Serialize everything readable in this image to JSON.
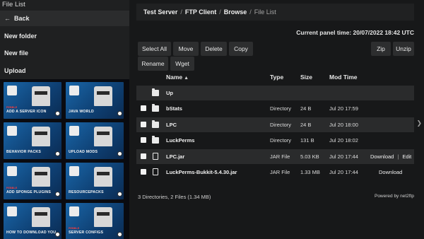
{
  "sidebar": {
    "title": "File List",
    "back_label": "Back",
    "new_folder_label": "New folder",
    "new_file_label": "New file",
    "upload_label": "Upload",
    "tiles": [
      {
        "caption": "ADD A SERVER ICON",
        "brand": "PEBBLE",
        "bg": "#1a66a8"
      },
      {
        "caption": "JAVA WORLD",
        "brand": "",
        "bg": "#1a66a8"
      },
      {
        "caption": "BEHAVIOR PACKS",
        "brand": "",
        "bg": "#1a66a8"
      },
      {
        "caption": "UPLOAD MODS",
        "brand": "",
        "bg": "#1a66a8"
      },
      {
        "caption": "ADD SPONGE PLUGINS",
        "brand": "PEBBLE",
        "bg": "#1a66a8"
      },
      {
        "caption": "RESOURCEPACKS",
        "brand": "",
        "bg": "#1a66a8"
      },
      {
        "caption": "HOW TO DOWNLOAD YOUR WORLD",
        "brand": "",
        "bg": "#1a66a8"
      },
      {
        "caption": "SERVER CONFIGS",
        "brand": "PEBBLE",
        "bg": "#1a66a8"
      }
    ]
  },
  "breadcrumb": {
    "items": [
      "Test Server",
      "FTP Client",
      "Browse"
    ],
    "current": "File List"
  },
  "panel_time": "Current panel time: 20/07/2022 18:42 UTC",
  "toolbar": {
    "select_all": "Select All",
    "move": "Move",
    "delete": "Delete",
    "copy": "Copy",
    "zip": "Zip",
    "unzip": "Unzip",
    "rename": "Rename",
    "wget": "Wget"
  },
  "table": {
    "headers": {
      "name": "Name",
      "type": "Type",
      "size": "Size",
      "mod_time": "Mod Time"
    },
    "up_label": "Up",
    "rows": [
      {
        "name": "bStats",
        "type": "Directory",
        "size": "24 B",
        "time": "Jul 20 17:59",
        "icon": "folder-icon"
      },
      {
        "name": "LPC",
        "type": "Directory",
        "size": "24 B",
        "time": "Jul 20 18:00",
        "icon": "folder-icon"
      },
      {
        "name": "LuckPerms",
        "type": "Directory",
        "size": "131 B",
        "time": "Jul 20 18:02",
        "icon": "folder-icon"
      },
      {
        "name": "LPC.jar",
        "type": "JAR File",
        "size": "5.03 KB",
        "time": "Jul 20 17:44",
        "icon": "file-icon",
        "download": "Download",
        "edit": "Edit"
      },
      {
        "name": "LuckPerms-Bukkit-5.4.30.jar",
        "type": "JAR File",
        "size": "1.33 MB",
        "time": "Jul 20 17:44",
        "icon": "file-icon",
        "download": "Download"
      }
    ]
  },
  "footer": {
    "summary": "3 Directories, 2 Files (1.34 MB)",
    "powered": "Powered by net2ftp"
  }
}
